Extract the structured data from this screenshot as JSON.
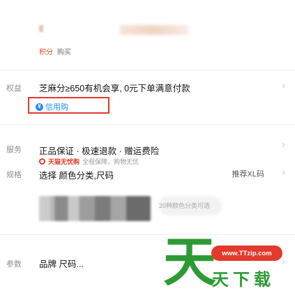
{
  "header": {
    "promo_tag": "积分",
    "buy_tag": "购买"
  },
  "benefits": {
    "label": "权益",
    "text": "芝麻分≥650有机会享, 0元下单满意付款",
    "credit_label": "信用购",
    "credit_icon": "credit-coin-icon"
  },
  "service": {
    "label": "服务",
    "text": "正品保证 · 极速退款 · 赠运费险",
    "tmall_brand": "天猫无忧购",
    "tmall_sub": "全程保障，购物无忧"
  },
  "spec": {
    "label": "规格",
    "text": "选择 颜色分类,尺码",
    "recommend": "推荐XL码",
    "note": "20种颜色分类可选"
  },
  "params": {
    "label": "参数",
    "text": "品牌 尺码..."
  },
  "watermark": {
    "badge": "www.TTzip.com",
    "big": "天",
    "small": "天下载"
  },
  "colors": {
    "highlight_red": "#e4392b",
    "credit_blue": "#2b8cf0",
    "watermark_green": "#2d9a34"
  }
}
